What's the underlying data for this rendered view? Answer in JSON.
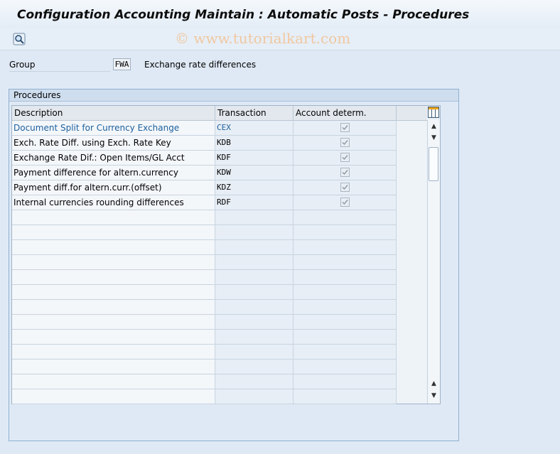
{
  "window": {
    "title": "Configuration Accounting Maintain : Automatic Posts - Procedures"
  },
  "watermark": "© www.tutorialkart.com",
  "toolbar": {
    "find_icon": "find-icon"
  },
  "group": {
    "label": "Group",
    "value": "FWA",
    "description": "Exchange rate differences"
  },
  "procedures": {
    "title": "Procedures",
    "columns": [
      "Description",
      "Transaction",
      "Account determ."
    ],
    "rows": [
      {
        "description": "Document Split for Currency Exchange",
        "transaction": "CEX",
        "account_determ": true
      },
      {
        "description": "Exch. Rate Diff. using Exch. Rate Key",
        "transaction": "KDB",
        "account_determ": true
      },
      {
        "description": "Exchange Rate Dif.: Open Items/GL Acct",
        "transaction": "KDF",
        "account_determ": true
      },
      {
        "description": "Payment difference for altern.currency",
        "transaction": "KDW",
        "account_determ": true
      },
      {
        "description": "Payment diff.for altern.curr.(offset)",
        "transaction": "KDZ",
        "account_determ": true
      },
      {
        "description": "Internal currencies rounding differences",
        "transaction": "RDF",
        "account_determ": true
      }
    ]
  },
  "colors": {
    "link": "#1b5f9e",
    "background": "#dfe9f5"
  }
}
